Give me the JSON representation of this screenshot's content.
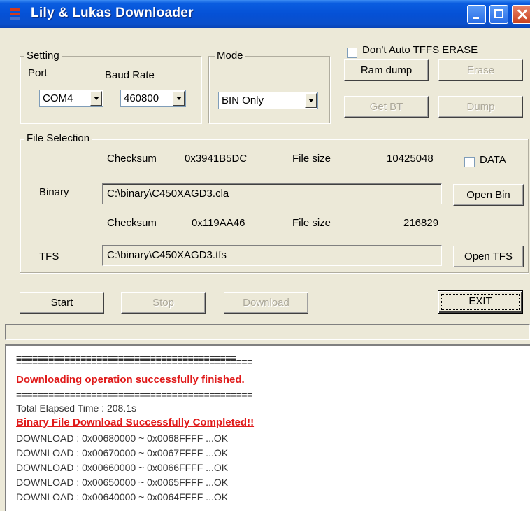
{
  "window": {
    "title": "Lily & Lukas Downloader",
    "accent": "#0551d6"
  },
  "setting": {
    "legend": "Setting",
    "port_label": "Port",
    "baud_label": "Baud Rate",
    "port_value": "COM4",
    "baud_value": "460800"
  },
  "mode": {
    "legend": "Mode",
    "value": "BIN Only"
  },
  "actions": {
    "dont_auto_tffs_erase": "Don't Auto TFFS ERASE",
    "ram_dump": "Ram dump",
    "erase": "Erase",
    "get_bt": "Get BT",
    "dump": "Dump"
  },
  "file_selection": {
    "legend": "File Selection",
    "binary": {
      "checksum_label": "Checksum",
      "checksum_value": "0x3941B5DC",
      "size_label": "File size",
      "size_value": "10425048",
      "label": "Binary",
      "path": "C:\\binary\\C450XAGD3.cla",
      "open_label": "Open Bin"
    },
    "data_checkbox": "DATA",
    "tfs": {
      "checksum_label": "Checksum",
      "checksum_value": "0x119AA46",
      "size_label": "File size",
      "size_value": "216829",
      "label": "TFS",
      "path": "C:\\binary\\C450XAGD3.tfs",
      "open_label": "Open TFS"
    }
  },
  "controls": {
    "start": "Start",
    "stop": "Stop",
    "download": "Download",
    "exit": "EXIT"
  },
  "log": {
    "separator": "============================================",
    "top_separator": "=========================================",
    "success_msg": "Downloading operation successfully finished.",
    "elapsed": "Total Elapsed Time : 208.1s",
    "binary_done": "Binary File Download Successfully Completed!!",
    "lines": [
      "DOWNLOAD : 0x00680000 ~ 0x0068FFFF ...OK",
      "DOWNLOAD : 0x00670000 ~ 0x0067FFFF ...OK",
      "DOWNLOAD : 0x00660000 ~ 0x0066FFFF ...OK",
      "DOWNLOAD : 0x00650000 ~ 0x0065FFFF ...OK",
      "DOWNLOAD : 0x00640000 ~ 0x0064FFFF ...OK"
    ]
  }
}
